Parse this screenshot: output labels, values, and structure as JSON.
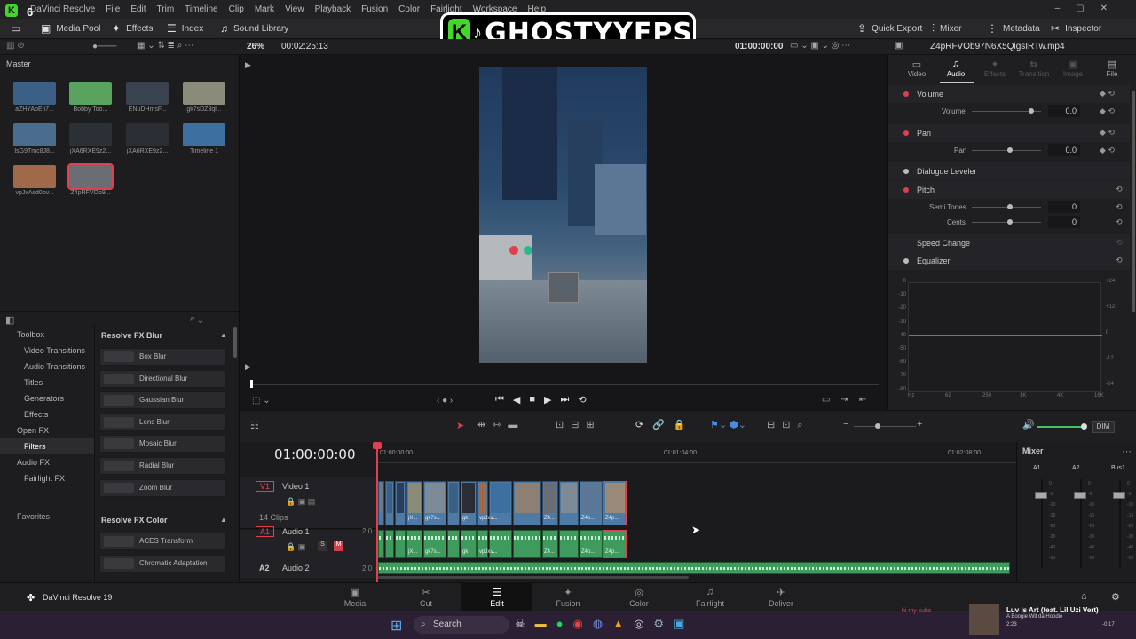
{
  "app": {
    "name": "DaVinci Resolve",
    "version_label": "DaVinci Resolve 19",
    "title": "Z4pRFVOb97N6X5QigsIRTw.mp4"
  },
  "menu": [
    "DaVinci Resolve",
    "File",
    "Edit",
    "Trim",
    "Timeline",
    "Clip",
    "Mark",
    "View",
    "Playback",
    "Fusion",
    "Color",
    "Fairlight",
    "Workspace",
    "Help"
  ],
  "toolbar": {
    "media_pool": "Media Pool",
    "effects": "Effects",
    "index": "Index",
    "sound_library": "Sound Library",
    "quick_export": "Quick Export",
    "mixer": "Mixer",
    "metadata": "Metadata",
    "inspector": "Inspector"
  },
  "overlay": {
    "badge": "6",
    "logo_text": "GHOSTYYFPS"
  },
  "viewer": {
    "zoom": "26%",
    "duration": "00:02:25:13",
    "timecode": "01:00:00:00"
  },
  "media_pool": {
    "title": "Master",
    "clips": [
      {
        "name": "aZHYAoEfi7...",
        "color": "#3b5f85"
      },
      {
        "name": "Bobby Too...",
        "color": "#5aa35e"
      },
      {
        "name": "ENuDHmsF...",
        "color": "#3a4250"
      },
      {
        "name": "gk7sDZ3ql...",
        "color": "#8a8b79"
      },
      {
        "name": "IsG9Tmc8J8...",
        "color": "#4a6d8d"
      },
      {
        "name": "jXA6RXE9z2...",
        "color": "#2b2f36"
      },
      {
        "name": "jXA6RXE9z2...",
        "color": "#2a2d33"
      },
      {
        "name": "Timeline 1",
        "color": "#3d6fa0"
      },
      {
        "name": "vpJxAsd0bv...",
        "color": "#a06a4a"
      },
      {
        "name": "Z4pRFVOb9...",
        "color": "#6a6e74"
      }
    ]
  },
  "effects": {
    "tree": [
      {
        "label": "Toolbox",
        "level": 0
      },
      {
        "label": "Video Transitions",
        "level": 1
      },
      {
        "label": "Audio Transitions",
        "level": 1
      },
      {
        "label": "Titles",
        "level": 1
      },
      {
        "label": "Generators",
        "level": 1
      },
      {
        "label": "Effects",
        "level": 1
      },
      {
        "label": "Open FX",
        "level": 0
      },
      {
        "label": "Filters",
        "level": 1
      },
      {
        "label": "Audio FX",
        "level": 0
      },
      {
        "label": "Fairlight FX",
        "level": 1
      }
    ],
    "favorites": "Favorites",
    "blur_header": "Resolve FX Blur",
    "blur_items": [
      "Box Blur",
      "Directional Blur",
      "Gaussian Blur",
      "Lens Blur",
      "Mosaic Blur",
      "Radial Blur",
      "Zoom Blur"
    ],
    "color_header": "Resolve FX Color",
    "color_items": [
      "ACES Transform",
      "Chromatic Adaptation"
    ]
  },
  "inspector": {
    "tabs": [
      "Video",
      "Audio",
      "Effects",
      "Transition",
      "Image",
      "File"
    ],
    "volume": {
      "label": "Volume",
      "param": "Volume",
      "value": "0.0"
    },
    "pan": {
      "label": "Pan",
      "param": "Pan",
      "value": "0.0"
    },
    "dialogue": "Dialogue Leveler",
    "pitch": {
      "label": "Pitch",
      "semi_label": "Semi Tones",
      "semi": "0",
      "cents_label": "Cents",
      "cents": "0"
    },
    "speed": "Speed Change",
    "equalizer": "Equalizer",
    "eq_left": [
      "0",
      "-10",
      "-20",
      "-30",
      "-40",
      "-50",
      "-60",
      "-70",
      "-80"
    ],
    "eq_right": [
      "+24",
      "+12",
      "0",
      "-12",
      "-24"
    ],
    "eq_freq": [
      "Hz",
      "62",
      "250",
      "1K",
      "4K",
      "16K"
    ]
  },
  "timeline": {
    "timecode": "01:00:00:00",
    "ruler": [
      "01:00:00:00",
      "01:01:04:00",
      "01:02:08:00"
    ],
    "v1": {
      "id": "V1",
      "name": "Video 1",
      "clips": "14 Clips"
    },
    "a1": {
      "id": "A1",
      "name": "Audio 1",
      "ch": "2.0",
      "s": "S",
      "m": "M"
    },
    "a2": {
      "id": "A2",
      "name": "Audio 2",
      "ch": "2.0"
    },
    "clip_labels": [
      "gk",
      "gk7s...",
      "jX...",
      "vpJx...",
      "v...",
      "Z4...",
      "Z4p...",
      "Z4p..."
    ],
    "dim": "DIM"
  },
  "mixer": {
    "title": "Mixer",
    "channels": [
      "A1",
      "A2",
      "Bus1"
    ],
    "scale": [
      "0",
      "-5",
      "-10",
      "-15",
      "-20",
      "-30",
      "-40",
      "-50"
    ]
  },
  "pages": [
    "Media",
    "Cut",
    "Edit",
    "Fusion",
    "Color",
    "Fairlight",
    "Deliver"
  ],
  "active_page": "Edit",
  "taskbar": {
    "search": "Search",
    "notice": "hi my subs",
    "song": "Luv Is Art (feat. Lil Uzi Vert)",
    "artist": "A Boogie Wit da Hoodie",
    "t1": "2:23",
    "t2": "-0:17"
  }
}
